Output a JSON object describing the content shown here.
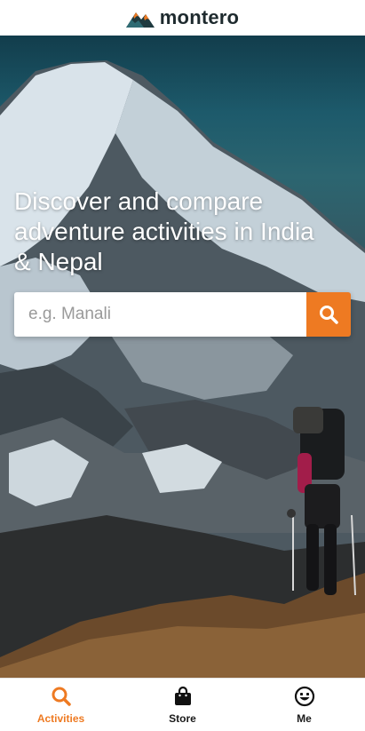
{
  "brand": {
    "name": "montero"
  },
  "hero": {
    "headline": "Discover and compare adventure activities in India & Nepal"
  },
  "search": {
    "placeholder": "e.g. Manali",
    "value": ""
  },
  "nav": {
    "items": [
      {
        "label": "Activities",
        "icon": "search-icon",
        "active": true
      },
      {
        "label": "Store",
        "icon": "shopping-bag-icon",
        "active": false
      },
      {
        "label": "Me",
        "icon": "smiley-face-icon",
        "active": false
      }
    ]
  },
  "colors": {
    "accent": "#ee7a22",
    "text_dark": "#1e2a2e",
    "sky": "#1d5a6b"
  }
}
